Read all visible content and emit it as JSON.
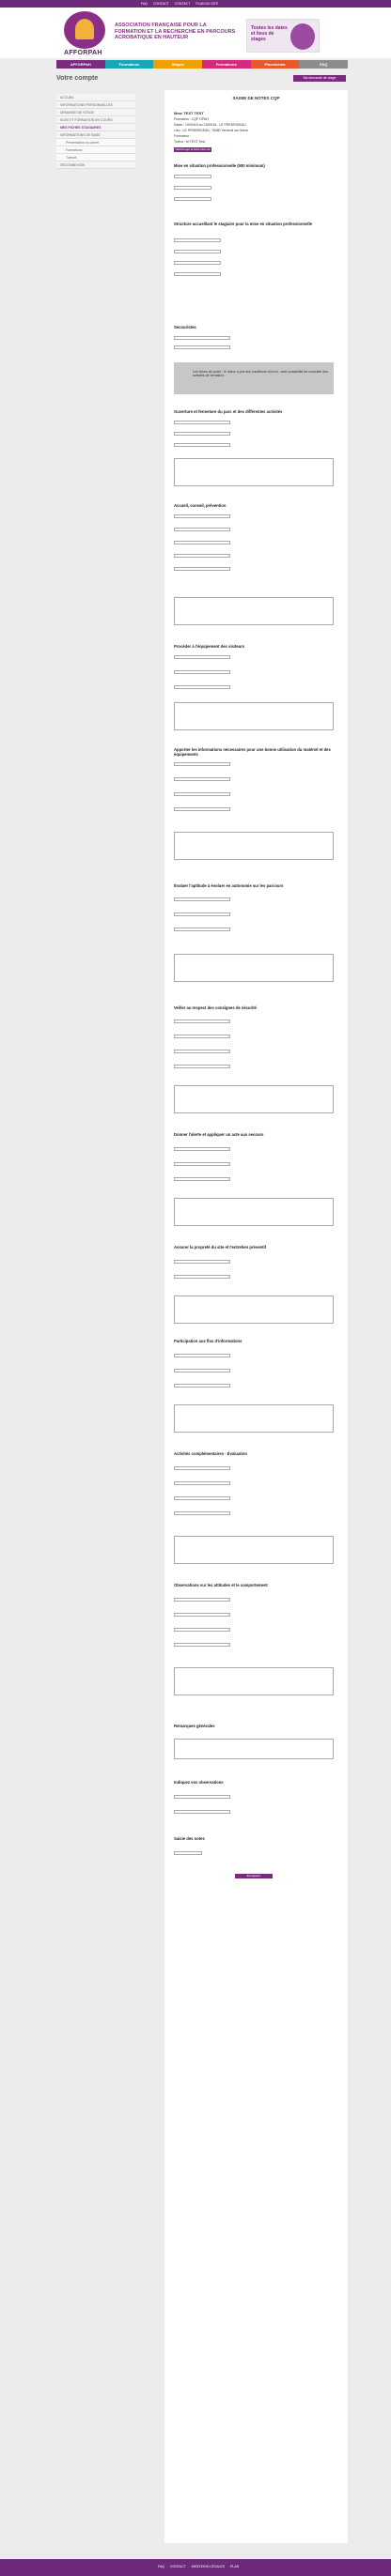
{
  "topbar": {
    "links": [
      "FAQ",
      "CONTACT",
      "CONTACT",
      "PLAN DU SITE"
    ]
  },
  "header": {
    "logo": "AFFORPAH",
    "tagline": "ASSOCIATION FRANÇAISE POUR LA FORMATION ET LA RECHERCHE EN PARCOURS ACROBATIQUE EN HAUTEUR",
    "promo": "Toutes les dates et lieux de stages"
  },
  "nav": [
    {
      "label": "AFFORPAH",
      "color": "#7a2b7e"
    },
    {
      "label": "Formations",
      "color": "#1aa7b5"
    },
    {
      "label": "Stages",
      "color": "#f0a000"
    },
    {
      "label": "Formateurs",
      "color": "#d42a7b"
    },
    {
      "label": "Placements",
      "color": "#e8582a"
    },
    {
      "label": "FAQ",
      "color": "#8c8c8c"
    }
  ],
  "page": {
    "title": "Votre compte",
    "back": "Ma demande de stage"
  },
  "sidebar": [
    {
      "label": "ACCUEIL",
      "sub": false,
      "active": false
    },
    {
      "label": "INFORMATIONS PERSONNELLES",
      "sub": false,
      "active": false
    },
    {
      "label": "DEMANDE DE STAGE",
      "sub": false,
      "active": false
    },
    {
      "label": "SUIVI ET FORMATION EN COURS",
      "sub": false,
      "active": false
    },
    {
      "label": "MES FICHES STAGIAIRES",
      "sub": false,
      "active": true
    },
    {
      "label": "INFORMATIONS DE BASE",
      "sub": false,
      "active": false
    },
    {
      "label": "Présentation du carnet",
      "sub": true,
      "active": false
    },
    {
      "label": "Formations",
      "sub": true,
      "active": false
    },
    {
      "label": "Tuteurs",
      "sub": true,
      "active": false
    },
    {
      "label": "DÉCONNEXION",
      "sub": false,
      "active": false
    }
  ],
  "form": {
    "title": "SAISIE DE NOTES CQP",
    "name": "Mme TEST TEST",
    "formation": "Formation : CQP OPAH",
    "dates": "Dates : 19/09/16 au 23/09/16 - LE PERDRIGEAU",
    "lieu": "Lieu : LE PERDRIGEAU, 78480 Verneuil sur Seine",
    "formateur": "Formateur :",
    "tuteur": "Tuteur : M TEST Test",
    "button_fiche": "Télécharger la fiche bilan de stage",
    "sections": [
      "Mise en situation professionnelle (500 minimum)",
      "Structure accueillant le stagiaire pour la mise en situation professionnelle",
      "Secouristes",
      "Ouverture et fermeture du parc et des différentes activités",
      "Accueil, conseil, prévention",
      "Procéder à l'équipement des visiteurs",
      "Apporter les informations nécessaires pour une bonne utilisation du matériel et des équipements",
      "Évaluer l'aptitude à évoluer en autonomie sur les parcours",
      "Veiller au respect des consignes de sécurité",
      "Donner l'alerte et appliquer un acte aux secours",
      "Assurer la propreté du site et l'entretien préventif",
      "Participation aux flux d'informations",
      "Activités complémentaires - Évaluation",
      "Observations sur les attitudes et le comportement",
      "Remarques générales",
      "Indiquez vos observations",
      "Saisie des notes"
    ],
    "notice": "Les fiches de poste : le tuteur a pris des conditions d'envoi - avec possibilité de consulter des activités de formation.",
    "submit": "Enregistrer"
  },
  "footer": {
    "links": [
      "FAQ",
      "CONTACT",
      "MENTIONS LÉGALES",
      "PLAN"
    ]
  }
}
